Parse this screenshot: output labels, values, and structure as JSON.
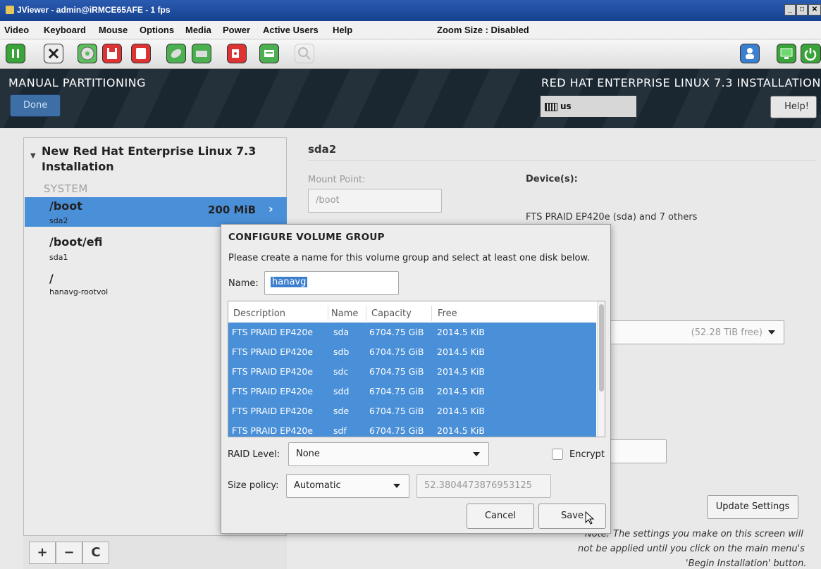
{
  "window": {
    "title": "JViewer - admin@iRMCE65AFE - 1 fps",
    "controls": [
      "minimize",
      "maximize",
      "close"
    ]
  },
  "menubar": {
    "items": [
      "Video",
      "Keyboard",
      "Mouse",
      "Options",
      "Media",
      "Power",
      "Active Users",
      "Help"
    ],
    "zoom": "Zoom Size : Disabled"
  },
  "toolbar": {
    "icons": [
      "pause-icon",
      "fullscreen-icon",
      "cd-icon",
      "floppy-icon",
      "usb-icon",
      "mouse-icon",
      "keyboard-icon",
      "record-icon",
      "soft-keyboard-icon",
      "zoom-icon",
      "users-icon",
      "display-icon",
      "power-icon"
    ]
  },
  "header": {
    "title": "MANUAL PARTITIONING",
    "done_label": "Done",
    "product": "RED HAT ENTERPRISE LINUX 7.3 INSTALLATION",
    "keyboard_layout": "us",
    "help_label": "Help!"
  },
  "leftpane": {
    "group_title": "New Red Hat Enterprise Linux 7.3 Installation",
    "system_label": "SYSTEM",
    "mounts": [
      {
        "mount": "/boot",
        "device": "sda2",
        "size": "200 MiB",
        "selected": true
      },
      {
        "mount": "/boot/efi",
        "device": "sda1"
      },
      {
        "mount": "/",
        "device": "hanavg-rootvol"
      }
    ],
    "add_label": "+",
    "remove_label": "−",
    "refresh_label": "C"
  },
  "rightpane": {
    "section_title": "sda2",
    "mount_point_label": "Mount Point:",
    "mount_point_value": "/boot",
    "devices_label": "Device(s):",
    "devices_value": "FTS PRAID EP420e (sda) and 7 others",
    "vg_free": "(52.28 TiB free)",
    "update_label": "Update Settings",
    "note_prefix": "Note:",
    "note_line1": "The settings you make on this screen will",
    "note_line2": "not be applied until you click on the main menu's",
    "note_line3": "'Begin Installation' button."
  },
  "dialog": {
    "title": "CONFIGURE VOLUME GROUP",
    "description": "Please create a name for this volume group and select at least one disk below.",
    "name_label": "Name:",
    "name_value": "hanavg",
    "columns": [
      "Description",
      "Name",
      "Capacity",
      "Free"
    ],
    "disks": [
      {
        "description": "FTS PRAID EP420e",
        "name": "sda",
        "capacity": "6704.75 GiB",
        "free": "2014.5 KiB"
      },
      {
        "description": "FTS PRAID EP420e",
        "name": "sdb",
        "capacity": "6704.75 GiB",
        "free": "2014.5 KiB"
      },
      {
        "description": "FTS PRAID EP420e",
        "name": "sdc",
        "capacity": "6704.75 GiB",
        "free": "2014.5 KiB"
      },
      {
        "description": "FTS PRAID EP420e",
        "name": "sdd",
        "capacity": "6704.75 GiB",
        "free": "2014.5 KiB"
      },
      {
        "description": "FTS PRAID EP420e",
        "name": "sde",
        "capacity": "6704.75 GiB",
        "free": "2014.5 KiB"
      },
      {
        "description": "FTS PRAID EP420e",
        "name": "sdf",
        "capacity": "6704.75 GiB",
        "free": "2014.5 KiB"
      }
    ],
    "raid_label": "RAID Level:",
    "raid_value": "None",
    "encrypt_label": "Encrypt",
    "encrypt_checked": false,
    "size_policy_label": "Size policy:",
    "size_policy_value": "Automatic",
    "size_value": "52.3804473876953125",
    "cancel_label": "Cancel",
    "save_label": "Save"
  }
}
